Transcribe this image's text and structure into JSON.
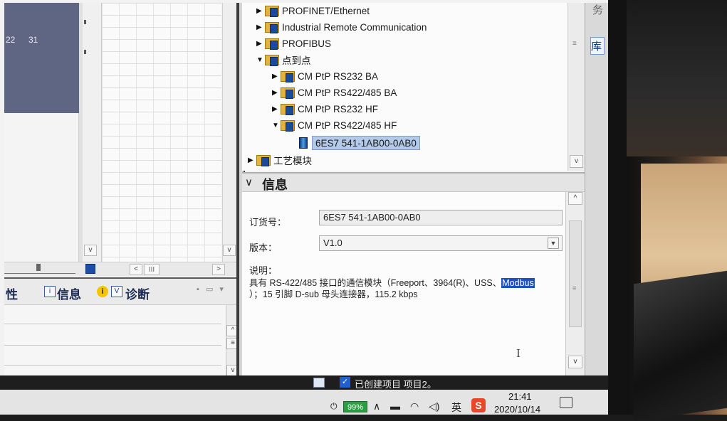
{
  "left_panel": {
    "calendar_cells": [
      "22",
      "31"
    ],
    "hscroll": {
      "left": "<",
      "mid": "III",
      "right": ">"
    },
    "vscroll_down": "v"
  },
  "inspector": {
    "tab_properties": "性",
    "tab_info": "信息",
    "tab_diagnostics": "诊断",
    "info_icon": "i",
    "window_buttons": "▪ ▭ ▾"
  },
  "catalog": {
    "items": [
      {
        "label": "PROFINET/Ethernet",
        "arrow": "▶"
      },
      {
        "label": "Industrial Remote Communication",
        "arrow": "▶"
      },
      {
        "label": "PROFIBUS",
        "arrow": "▶"
      },
      {
        "label": "点到点",
        "arrow": "▼"
      },
      {
        "label": "CM PtP RS232 BA",
        "arrow": "▶"
      },
      {
        "label": "CM PtP RS422/485 BA",
        "arrow": "▶"
      },
      {
        "label": "CM PtP RS232 HF",
        "arrow": "▶"
      },
      {
        "label": "CM PtP RS422/485 HF",
        "arrow": "▼"
      },
      {
        "label": "6ES7 541-1AB00-0AB0",
        "arrow": ""
      },
      {
        "label": "工艺模块",
        "arrow": "▶"
      }
    ],
    "scroll_down": "v"
  },
  "side_tabs": [
    "务",
    "库"
  ],
  "info_panel": {
    "title": "信息",
    "order_label": "订货号：",
    "order_value": "6ES7 541-1AB00-0AB0",
    "version_label": "版本：",
    "version_value": "V1.0",
    "desc_label": "说明：",
    "desc_text_1": "具有 RS-422/485 接口的通信模块（Freeport、3964(R)、USS、",
    "desc_highlight": "Modbus",
    "desc_text_2": "）；15 引脚 D-sub 母头连接器，115.2 kbps",
    "cursor": "I"
  },
  "status_bar": {
    "message": "已创建项目 项目2。"
  },
  "taskbar": {
    "battery": "99%",
    "ime_cn": "英",
    "ime_s": "S",
    "time": "21:41",
    "date": "2020/10/14"
  }
}
